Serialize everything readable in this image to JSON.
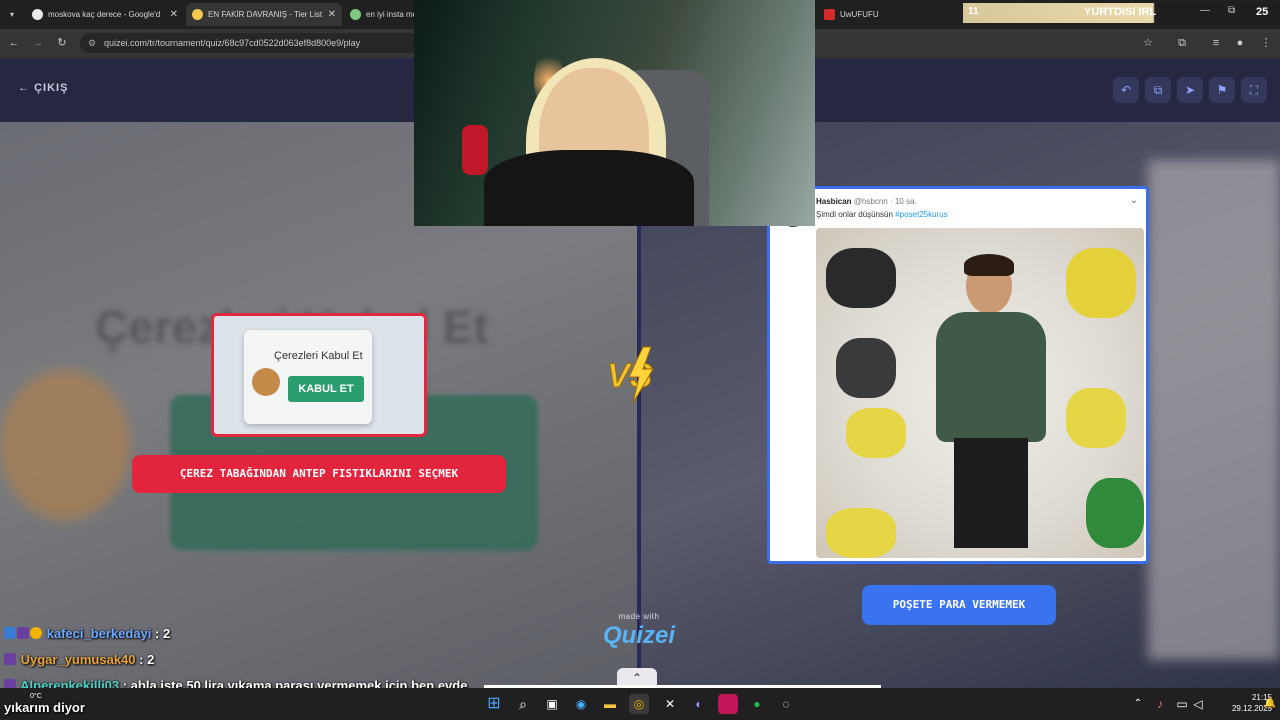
{
  "browser": {
    "tabs": [
      {
        "title": "moskova kaç derece - Google'd"
      },
      {
        "title": "EN FAKİR DAVRANIŞ - Tier List"
      },
      {
        "title": "en iyi insta me"
      },
      {
        "title": "UwUFUFU"
      }
    ],
    "url": "quizei.com/tr/tournament/quiz/68c97cd0522d063ef8d800e9/play"
  },
  "stream_overlay": {
    "number": "11",
    "title": "YURTDISI IRL",
    "count": "25"
  },
  "quiz": {
    "exit_label": "ÇIKIŞ",
    "left_option": {
      "card_title": "Çerezleri Kabul Et",
      "card_button": "KABUL ET",
      "label": "ÇEREZ TABAĞINDAN ANTEP FISTIKLARINI SEÇMEK",
      "background_text": "Çerezleri Kabul Et"
    },
    "right_option": {
      "tweet_user": "Hasbican",
      "tweet_handle": "@hsbcnn · 10 sa.",
      "tweet_text": "Şimdi onlar düşünsün",
      "tweet_hashtag": "#poset25kurus",
      "label": "POŞETE PARA VERMEMEK"
    },
    "vs_label": "VS",
    "made_with": "made with",
    "brand": "Quizei"
  },
  "chat": [
    {
      "user": "kafeci_berkedayi",
      "message": ": 2",
      "color": "#6fa8ff"
    },
    {
      "user": "Uygar_yumusak40",
      "message": ": 2",
      "color": "#e6a23c"
    },
    {
      "user": "Alperenkekilli03",
      "message": ": abla işte 50 lira yıkama parası vermemek için ben evde",
      "color": "#4fd1c5"
    },
    {
      "user": "",
      "message": "yıkarım diyor",
      "color": "#ffffff"
    }
  ],
  "taskbar": {
    "weather": "0°C",
    "time": "21:15",
    "date": "29.12.2025"
  },
  "colors": {
    "accent_red": "#e2253d",
    "accent_blue": "#3a73f0",
    "header_bg": "#262841",
    "brand_blue": "#5ab3f5"
  }
}
